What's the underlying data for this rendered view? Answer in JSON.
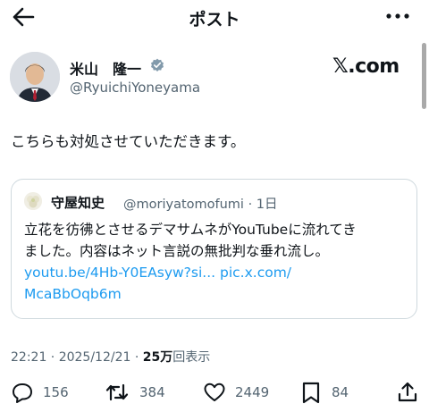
{
  "header": {
    "title": "ポスト",
    "back_icon": "arrow-left-icon",
    "more_icon": "more-dots-icon"
  },
  "author": {
    "name": "米山　隆一",
    "handle": "@RyuichiYoneyama",
    "verified_icon": "verified-badge-icon"
  },
  "brand": "𝕏.com",
  "post": {
    "text": "こちらも対処させていただきます。"
  },
  "quote": {
    "name": "守屋知史",
    "handle_time": "@moriyatomofumi · 1日",
    "lines": [
      "立花を彷彿とさせるデマサムネがYouTubeに流れてき",
      "ました。内容はネット言説の無批判な垂れ流し。"
    ],
    "link1": "youtu.be/4Hb-Y0EAsyw?si...",
    "link2": "pic.x.com/",
    "link3": "McaBbOqb6m"
  },
  "meta": {
    "time_date": "22:21 · 2025/12/21 · ",
    "views_count": "25万",
    "views_label": "回表示"
  },
  "actions": {
    "replies": "156",
    "reposts": "384",
    "likes": "2449",
    "bookmarks": "84"
  },
  "colors": {
    "text": "#0f1419",
    "secondary": "#536471",
    "link": "#1d9bf0",
    "verified": "#829aab",
    "border": "#cfd9de"
  }
}
